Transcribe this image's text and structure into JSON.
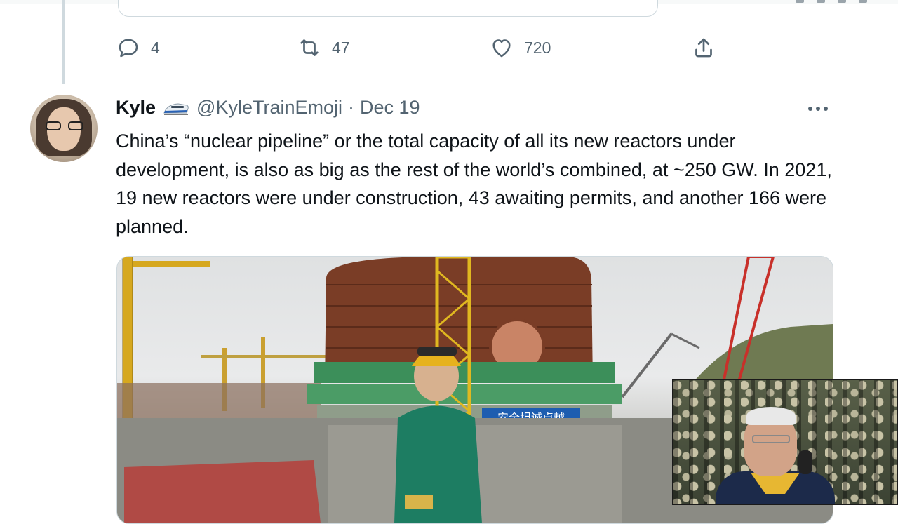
{
  "previous_tweet": {
    "actions": {
      "reply_count": "4",
      "retweet_count": "47",
      "like_count": "720"
    }
  },
  "tweet": {
    "author_name": "Kyle",
    "handle": "@KyleTrainEmoji",
    "separator": "·",
    "date": "Dec 19",
    "text": "China’s “nuclear pipeline” or the total capacity of all its new reactors under development, is also as big as the rest of the world’s combined, at ~250 GW. In 2021, 19 new reactors were under construction, 43 awaiting permits, and another 166 were planned.",
    "photo_sign_text": "安全坦诚卓越"
  },
  "icons": {
    "reply": "speech-bubble-icon",
    "retweet": "retweet-arrows-icon",
    "like": "heart-icon",
    "share": "share-upload-icon",
    "more": "ellipsis-icon",
    "name_badge": "bullet-train-emoji"
  },
  "colors": {
    "secondary_text": "#536471",
    "primary_text": "#0f1419",
    "border": "#cfd9de"
  }
}
